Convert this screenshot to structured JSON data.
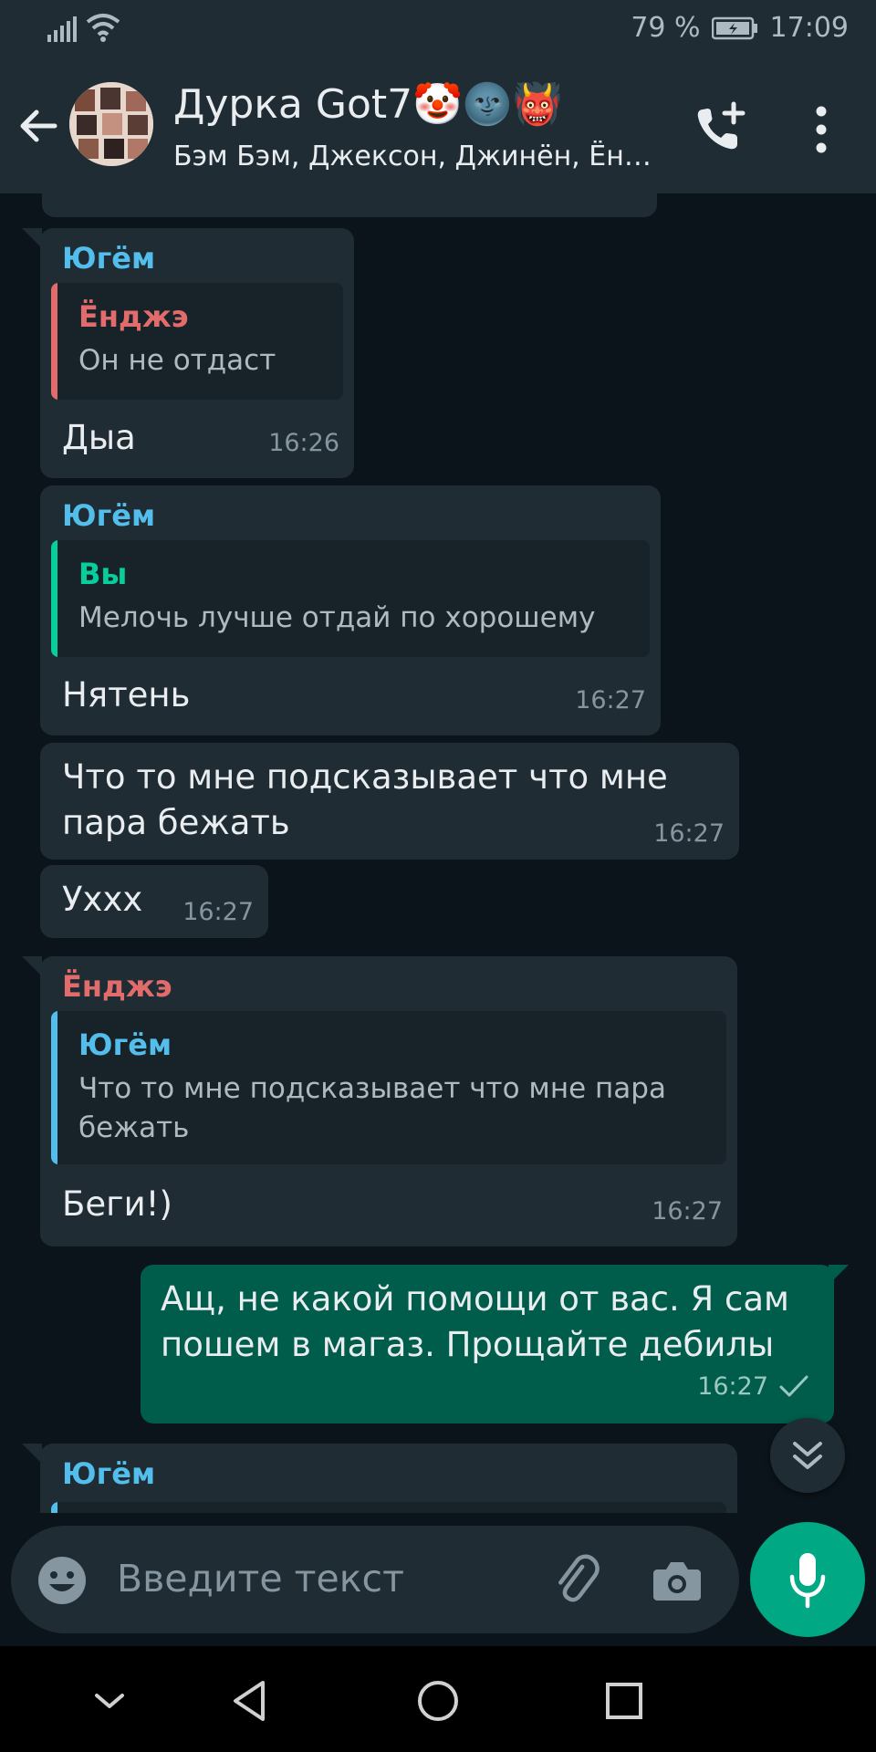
{
  "status_bar": {
    "battery": "79 %",
    "time": "17:09",
    "signal_icon": "signal-icon",
    "wifi_icon": "wifi-icon",
    "battery_icon": "battery-charging-icon"
  },
  "header": {
    "title": "Дурка Got7🤡🌚👹",
    "subtitle": "Бэм Бэм, Джексон, Джинён, Ён…",
    "back_icon": "arrow-back-icon",
    "call_icon": "add-call-icon",
    "menu_icon": "more-vert-icon"
  },
  "colors": {
    "background": "#0b141a",
    "bar": "#1f2c34",
    "incoming": "#1f2c34",
    "outgoing": "#005c4b",
    "accent": "#00a884",
    "sender_yugyeom": "#53bdeb",
    "sender_youngjae": "#e26b6b",
    "sender_you": "#06cf9c"
  },
  "messages": [
    {
      "sender": "Югём",
      "quote_name": "Ёнджэ",
      "quote_text": "Он не отдаст",
      "text": "Дыа",
      "time": "16:26"
    },
    {
      "sender": "Югём",
      "quote_name": "Вы",
      "quote_text": "Мелочь лучше отдай по хорошему",
      "text": "Нятень",
      "time": "16:27"
    },
    {
      "text_line1": "Что то мне подсказывает что мне",
      "text_line2": "пара бежать",
      "time": "16:27"
    },
    {
      "text": "Ухxx",
      "time": "16:27"
    },
    {
      "sender": "Ёнджэ",
      "quote_name": "Югём",
      "quote_line1": "Что то мне подсказывает что мне пара",
      "quote_line2": "бежать",
      "text": "Беги!)",
      "time": "16:27"
    },
    {
      "text_line1": "Ащ, не какой помощи от вас. Я сам",
      "text_line2": "пошем в магаз. Прощайте дебилы",
      "time": "16:27",
      "status_icon": "single-check-icon"
    },
    {
      "sender": "Югём"
    }
  ],
  "input": {
    "placeholder": "Введите текст",
    "emoji_icon": "emoji-icon",
    "attach_icon": "paperclip-icon",
    "camera_icon": "camera-icon",
    "mic_icon": "mic-icon"
  },
  "nav": {
    "down_icon": "chevron-down-icon",
    "back_icon": "triangle-back-icon",
    "home_icon": "circle-home-icon",
    "recents_icon": "square-recents-icon"
  }
}
